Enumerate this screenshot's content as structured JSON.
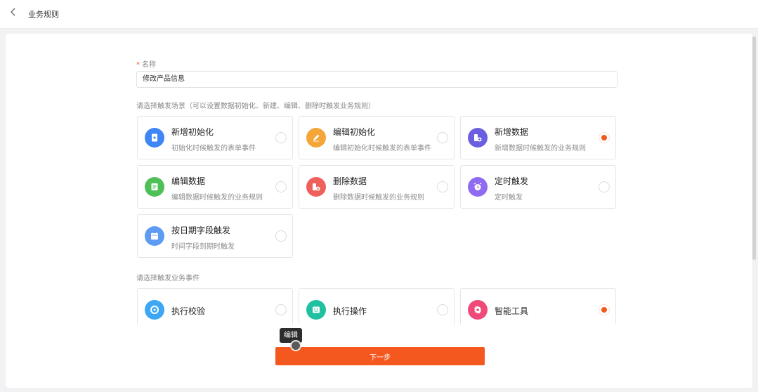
{
  "header": {
    "back_icon": "chevron-left-icon",
    "title": "业务规则"
  },
  "form": {
    "name_label": "名称",
    "name_value": "修改产品信息",
    "trigger_label": "请选择触发场景（可以设置数据初始化、新建、编辑、删除时触发业务规则）",
    "event_label": "请选择触发业务事件"
  },
  "triggers": [
    {
      "title": "新增初始化",
      "desc": "初始化时候触发的表单事件",
      "icon": "add-doc-icon",
      "color": "#3f86f5",
      "checked": false
    },
    {
      "title": "编辑初始化",
      "desc": "编辑初始化时候触发的表单事件",
      "icon": "pencil-icon",
      "color": "#f5a638",
      "checked": false
    },
    {
      "title": "新增数据",
      "desc": "新增数据时候触发的业务规则",
      "icon": "data-add-icon",
      "color": "#6a5fe0",
      "checked": true
    },
    {
      "title": "编辑数据",
      "desc": "编辑数据时候触发的业务规则",
      "icon": "data-edit-icon",
      "color": "#4fbf57",
      "checked": false
    },
    {
      "title": "删除数据",
      "desc": "删除数据时候触发的业务规则",
      "icon": "data-delete-icon",
      "color": "#f0605a",
      "checked": false
    },
    {
      "title": "定时触发",
      "desc": "定时触发",
      "icon": "alarm-clock-icon",
      "color": "#8e6bf0",
      "checked": false
    },
    {
      "title": "按日期字段触发",
      "desc": "时间字段到期时触发",
      "icon": "calendar-icon",
      "color": "#5d9cf2",
      "checked": false
    }
  ],
  "events": [
    {
      "title": "执行校验",
      "icon": "check-circle-icon",
      "color": "#3da6f5",
      "checked": false
    },
    {
      "title": "执行操作",
      "icon": "operation-icon",
      "color": "#20c1a1",
      "checked": false
    },
    {
      "title": "智能工具",
      "icon": "gear-icon",
      "color": "#f04a78",
      "checked": true
    }
  ],
  "tooltip": "编辑",
  "next_button": "下一步"
}
